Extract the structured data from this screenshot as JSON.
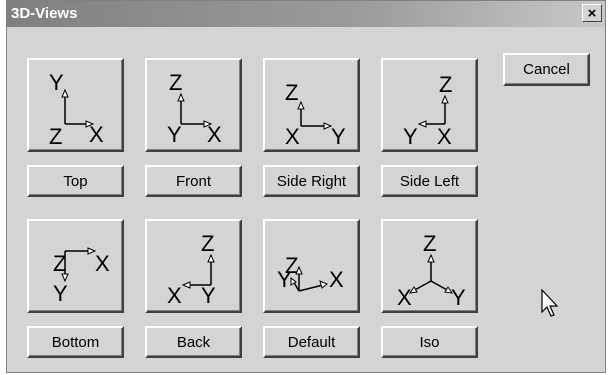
{
  "window": {
    "title": "3D-Views",
    "close_label": "×"
  },
  "cancel_label": "Cancel",
  "views": [
    {
      "label": "Top",
      "axis_labels": [
        "Y",
        "Z",
        "X"
      ]
    },
    {
      "label": "Front",
      "axis_labels": [
        "Z",
        "Y",
        "X"
      ]
    },
    {
      "label": "Side Right",
      "axis_labels": [
        "Z",
        "X",
        "Y"
      ]
    },
    {
      "label": "Side Left",
      "axis_labels": [
        "Z",
        "Y",
        "X"
      ]
    },
    {
      "label": "Bottom",
      "axis_labels": [
        "Z",
        "X",
        "Y"
      ]
    },
    {
      "label": "Back",
      "axis_labels": [
        "Z",
        "X",
        "Y"
      ]
    },
    {
      "label": "Default",
      "axis_labels": [
        "Y",
        "Z",
        "X"
      ]
    },
    {
      "label": "Iso",
      "axis_labels": [
        "Z",
        "X",
        "Y"
      ]
    }
  ]
}
